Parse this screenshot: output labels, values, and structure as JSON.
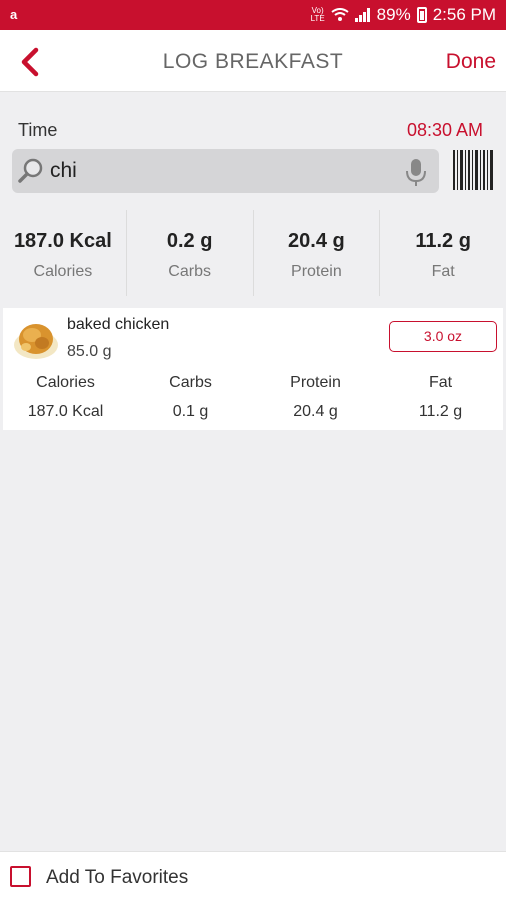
{
  "status_bar": {
    "app_badge": "a",
    "network_label": "Vo)) LTE",
    "battery": "89%",
    "time": "2:56 PM",
    "accent_color": "#c8102e",
    "icons": [
      "notification-icon",
      "volte-icon",
      "wifi-icon",
      "signal-icon",
      "battery-icon"
    ]
  },
  "header": {
    "title": "LOG BREAKFAST",
    "done_label": "Done",
    "back_icon": "chevron-left-icon"
  },
  "time": {
    "label": "Time",
    "value": "08:30 AM"
  },
  "search": {
    "query": "chi",
    "icons": [
      "search-icon",
      "microphone-icon",
      "barcode-icon"
    ]
  },
  "summary": [
    {
      "value": "187.0 Kcal",
      "label": "Calories"
    },
    {
      "value": "0.2 g",
      "label": "Carbs"
    },
    {
      "value": "20.4 g",
      "label": "Protein"
    },
    {
      "value": "11.2 g",
      "label": "Fat"
    }
  ],
  "food": {
    "name": "baked chicken",
    "weight": "85.0 g",
    "serving": "3.0 oz",
    "image_icon": "baked-chicken-image",
    "headers": [
      "Calories",
      "Carbs",
      "Protein",
      "Fat"
    ],
    "values": [
      "187.0 Kcal",
      "0.1 g",
      "20.4 g",
      "11.2 g"
    ]
  },
  "favorites": {
    "label": "Add To Favorites",
    "checked": false
  }
}
